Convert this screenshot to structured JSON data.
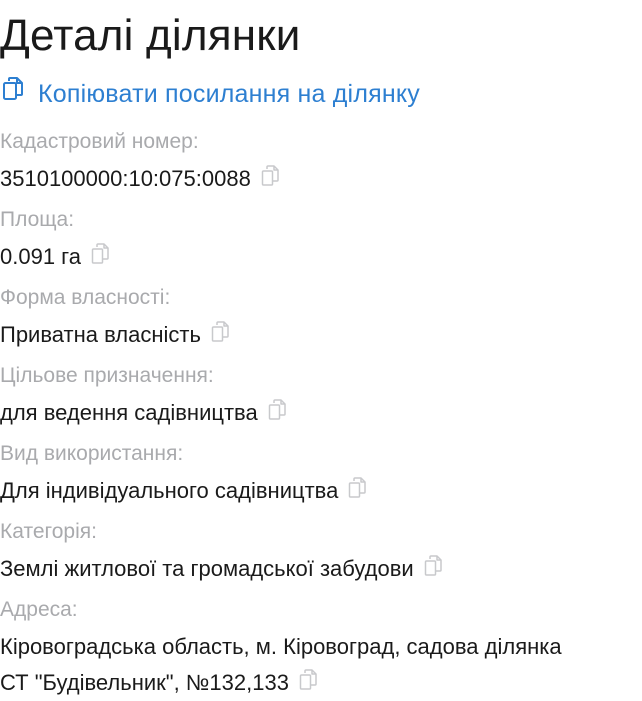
{
  "page": {
    "title": "Деталі ділянки",
    "copy_link_label": "Копіювати посилання на ділянку"
  },
  "fields": {
    "cadastral": {
      "label": "Кадастровий номер:",
      "value": "3510100000:10:075:0088"
    },
    "area": {
      "label": "Площа:",
      "value": "0.091 га"
    },
    "ownership": {
      "label": "Форма власності:",
      "value": "Приватна власність"
    },
    "purpose": {
      "label": "Цільове призначення:",
      "value": "для ведення садівництва"
    },
    "usage": {
      "label": "Вид використання:",
      "value": "Для індивідуального садівництва"
    },
    "category": {
      "label": "Категорія:",
      "value": "Землі житлової та громадської забудови"
    },
    "address": {
      "label": "Адреса:",
      "line1": "Кіровоградська область, м. Кіровоград, садова ділянка",
      "line2": "СТ \"Будівельник\", №132,133"
    }
  },
  "icons": {
    "copy_link": "copy-link-icon",
    "copy": "copy-icon"
  },
  "colors": {
    "link": "#2d7fd1",
    "label": "#a9aaad",
    "text": "#1a1a1a",
    "icon": "#c8c9cc",
    "link_icon": "#2d7fd1"
  }
}
